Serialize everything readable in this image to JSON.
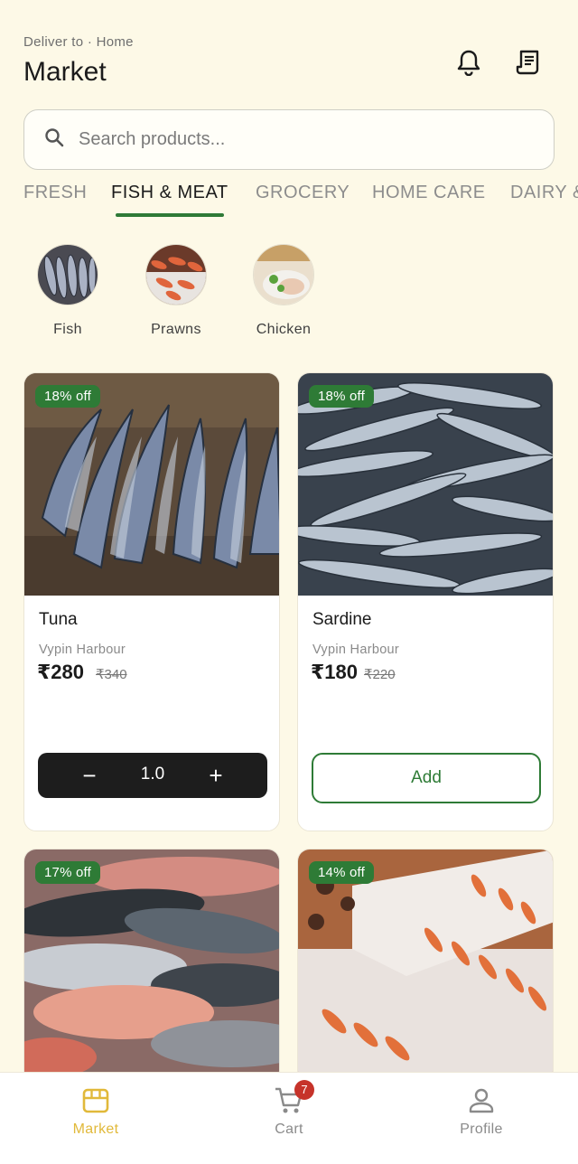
{
  "header": {
    "deliver_label": "Deliver to · Home",
    "title": "Market",
    "icons": [
      "bell-icon",
      "receipt-icon"
    ]
  },
  "search": {
    "placeholder": "Search products..."
  },
  "tabs": [
    {
      "label": "FRESH",
      "active": false
    },
    {
      "label": "FISH & MEAT",
      "active": true
    },
    {
      "label": "GROCERY",
      "active": false
    },
    {
      "label": "HOME CARE",
      "active": false
    },
    {
      "label": "DAIRY &",
      "active": false
    }
  ],
  "subcategories": [
    {
      "label": "Fish",
      "image": "fish-photo"
    },
    {
      "label": "Prawns",
      "image": "prawns-photo"
    },
    {
      "label": "Chicken",
      "image": "chicken-photo"
    }
  ],
  "products": [
    {
      "discount": "18% off",
      "name": "Tuna",
      "origin": "Vypin Harbour",
      "price": "₹280",
      "mrp": "₹340",
      "quantity": "1.0",
      "in_cart": true
    },
    {
      "discount": "18% off",
      "name": "Sardine",
      "origin": "Vypin Harbour",
      "price": "₹180",
      "mrp": "₹220",
      "add_label": "Add",
      "in_cart": false
    },
    {
      "discount": "17% off",
      "image": "mixed-fish-photo"
    },
    {
      "discount": "14% off",
      "image": "prawns-on-ice-photo"
    }
  ],
  "colors": {
    "background": "#fdf9e7",
    "accent_green": "#2e7b36",
    "nav_active": "#e1b93a",
    "badge_red": "#c6332a"
  },
  "bottom_nav": {
    "items": [
      {
        "label": "Market",
        "icon": "store-icon",
        "active": true
      },
      {
        "label": "Cart",
        "icon": "cart-icon",
        "badge": "7"
      },
      {
        "label": "Profile",
        "icon": "person-icon"
      }
    ]
  }
}
